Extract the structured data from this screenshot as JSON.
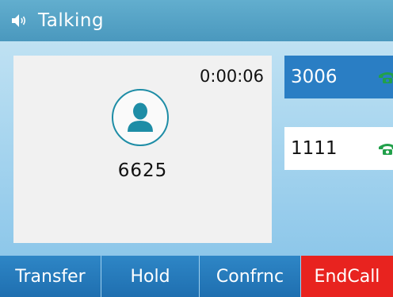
{
  "title_bar": {
    "icon": "speaker-icon",
    "title": "Talking"
  },
  "call": {
    "timer": "0:00:06",
    "avatar_icon": "contact-avatar-icon",
    "caller_number": "6625"
  },
  "lines": [
    {
      "label": "3006",
      "icon": "phone-handset-icon",
      "state": "active"
    },
    {
      "label": "1111",
      "icon": "phone-handset-icon",
      "state": "idle"
    }
  ],
  "softkeys": [
    {
      "label": "Transfer"
    },
    {
      "label": "Hold"
    },
    {
      "label": "Confrnc"
    },
    {
      "label": "EndCall"
    }
  ],
  "colors": {
    "title_bar": "#4a98be",
    "active_line": "#2a7ec4",
    "softkey_blue": "#1f6fb0",
    "endcall_red": "#e8231f",
    "handset_green": "#21a04a",
    "avatar_teal": "#1e8da6"
  }
}
